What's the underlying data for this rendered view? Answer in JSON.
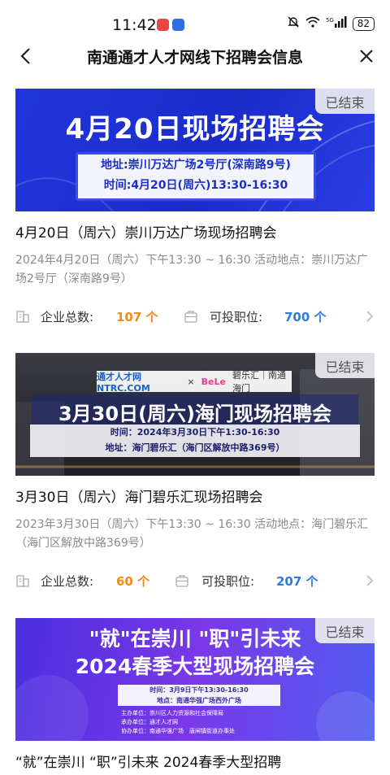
{
  "status_bar": {
    "time": "11:42",
    "battery": "82",
    "network": "5G"
  },
  "header": {
    "title": "南通通才人才网线下招聘会信息"
  },
  "labels": {
    "company_count": "企业总数:",
    "positions": "可投职位:"
  },
  "colors": {
    "count_company": "#f08a1c",
    "count_positions": "#2f7ae5"
  },
  "cards": [
    {
      "badge": "已结束",
      "banner": {
        "title": "4月20日现场招聘会",
        "address": "地址:崇川万达广场2号厅(深南路9号)",
        "time": "时间:4月20日(周六)13:30-16:30"
      },
      "title": "4月20日（周六）崇川万达广场现场招聘会",
      "desc": "2024年4月20日（周六）下午13:30 ~ 16:30 活动地点：崇川万达广场2号厅（深南路9号）",
      "companies": "107 个",
      "positions": "700 个"
    },
    {
      "badge": "已结束",
      "banner": {
        "logo_left": "通才人才网 NTRC.COM",
        "logo_x": "×",
        "logo_mid": "BeLe",
        "logo_right": "碧乐汇｜南通海门",
        "title": "3月30日(周六)海门现场招聘会",
        "time": "时间：2024年3月30日下午1:30-16:30",
        "address": "地址：海门碧乐汇（海门区解放中路369号）"
      },
      "title": "3月30日（周六）海门碧乐汇现场招聘会",
      "desc": "2023年3月30日（周六）下午13:30 ~ 16:30 活动地点：海门碧乐汇（海门区解放中路369号）",
      "companies": "60 个",
      "positions": "207 个"
    },
    {
      "badge": "已结束",
      "banner": {
        "line1": "\"就\"在崇川 \"职\"引未来",
        "line2": "2024春季大型现场招聘会",
        "time": "时间：3月9日下午13:30-16:30",
        "place": "地点：南通华强广场西外广场",
        "org1": "主办单位：崇川区人力资源和社会保障局",
        "org2": "承办单位：通才人才网",
        "org3": "协办单位：南通华强广场　唐闸镇街道办事处"
      },
      "title": "“就”在崇川 “职”引未来 2024春季大型招聘"
    }
  ]
}
